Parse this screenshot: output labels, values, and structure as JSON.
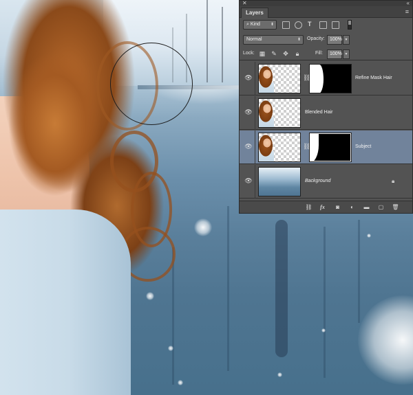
{
  "panel": {
    "tab_label": "Layers",
    "filter": {
      "kind_label": "Kind",
      "icons": [
        "image-filter-icon",
        "adjustment-filter-icon",
        "type-filter-icon",
        "shape-filter-icon",
        "smart-object-filter-icon"
      ]
    },
    "blend_mode": "Normal",
    "opacity_label": "Opacity:",
    "opacity_value": "100%",
    "lock_label": "Lock:",
    "fill_label": "Fill:",
    "fill_value": "100%",
    "layers": [
      {
        "name": "Refine Mask Hair",
        "has_mask": true,
        "selected": false,
        "visible": true,
        "italic": false,
        "locked": false
      },
      {
        "name": "Blended Hair",
        "has_mask": false,
        "selected": false,
        "visible": true,
        "italic": false,
        "locked": false
      },
      {
        "name": "Subject",
        "has_mask": true,
        "selected": true,
        "visible": true,
        "italic": false,
        "locked": false
      },
      {
        "name": "Background",
        "has_mask": false,
        "selected": false,
        "visible": true,
        "italic": true,
        "locked": true
      }
    ],
    "footer_icons": [
      "link-layers-icon",
      "fx-icon",
      "add-mask-icon",
      "adjustment-layer-icon",
      "new-group-icon",
      "new-layer-icon",
      "trash-icon"
    ]
  },
  "colors": {
    "panel_bg": "#535353",
    "selected_layer": "#71839b",
    "tab_bar": "#424242"
  }
}
